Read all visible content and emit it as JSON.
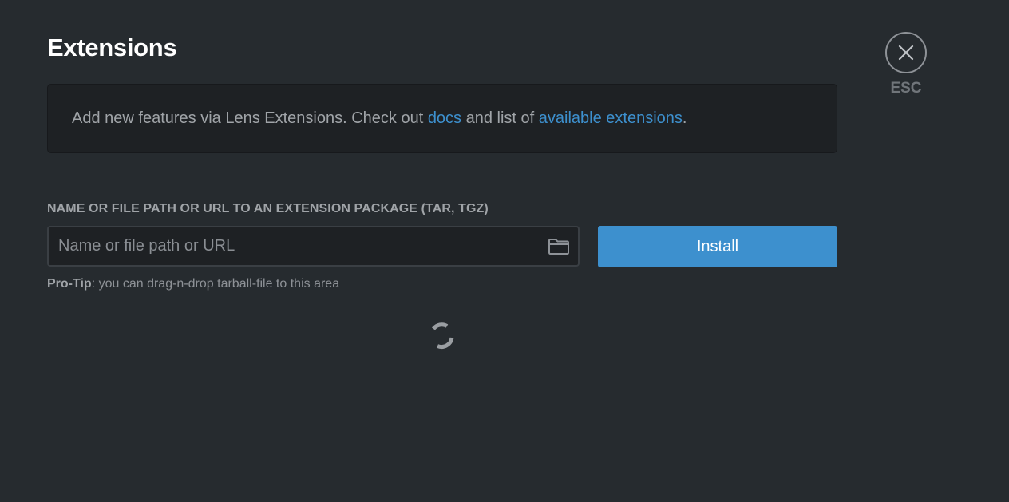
{
  "header": {
    "title": "Extensions"
  },
  "info": {
    "text_before": "Add new features via Lens Extensions. Check out ",
    "docs_link": "docs",
    "text_middle": " and list of ",
    "available_link": "available extensions",
    "text_after": "."
  },
  "install": {
    "field_label": "NAME OR FILE PATH OR URL TO AN EXTENSION PACKAGE (TAR, TGZ)",
    "input_value": "",
    "input_placeholder": "Name or file path or URL",
    "button_label": "Install",
    "tip_bold": "Pro-Tip",
    "tip_text": ": you can drag-n-drop tarball-file to this area",
    "folder_icon": "folder-icon"
  },
  "loader": {
    "icon": "spinner-icon"
  },
  "close": {
    "icon": "close-icon",
    "label": "ESC"
  },
  "colors": {
    "background": "#262b2f",
    "panel": "#1e2124",
    "accent": "#3d90ce",
    "text": "#a0a4a8"
  }
}
